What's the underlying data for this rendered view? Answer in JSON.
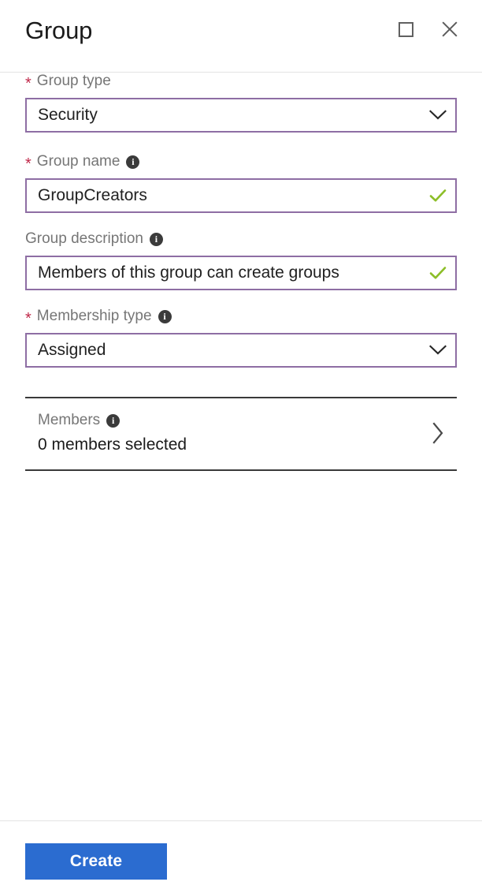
{
  "header": {
    "title": "Group",
    "maximize_icon": "maximize-icon",
    "close_icon": "close-icon"
  },
  "form": {
    "group_type": {
      "label": "Group type",
      "required": true,
      "required_marker": "*",
      "value": "Security",
      "control": "dropdown",
      "chevron_icon": "chevron-down-icon"
    },
    "group_name": {
      "label": "Group name",
      "required": true,
      "required_marker": "*",
      "info_icon": "info-icon",
      "value": "GroupCreators",
      "control": "textbox",
      "validation_icon": "checkmark-icon"
    },
    "group_description": {
      "label": "Group description",
      "required": false,
      "info_icon": "info-icon",
      "value": "Members of this group can create groups",
      "control": "textbox",
      "validation_icon": "checkmark-icon"
    },
    "membership_type": {
      "label": "Membership type",
      "required": true,
      "required_marker": "*",
      "info_icon": "info-icon",
      "value": "Assigned",
      "control": "dropdown",
      "chevron_icon": "chevron-down-icon"
    },
    "members": {
      "label": "Members",
      "info_icon": "info-icon",
      "value": "0 members selected",
      "chevron_icon": "chevron-right-icon"
    }
  },
  "footer": {
    "create_label": "Create"
  },
  "colors": {
    "field_border": "#8e6ea4",
    "required_star": "#c0294a",
    "label_text": "#767676",
    "value_text": "#1b1b1b",
    "valid_check": "#8cbe28",
    "primary_button": "#2b6cd0",
    "section_rule": "#3a3a3a",
    "header_rule": "#e4e4e4"
  }
}
